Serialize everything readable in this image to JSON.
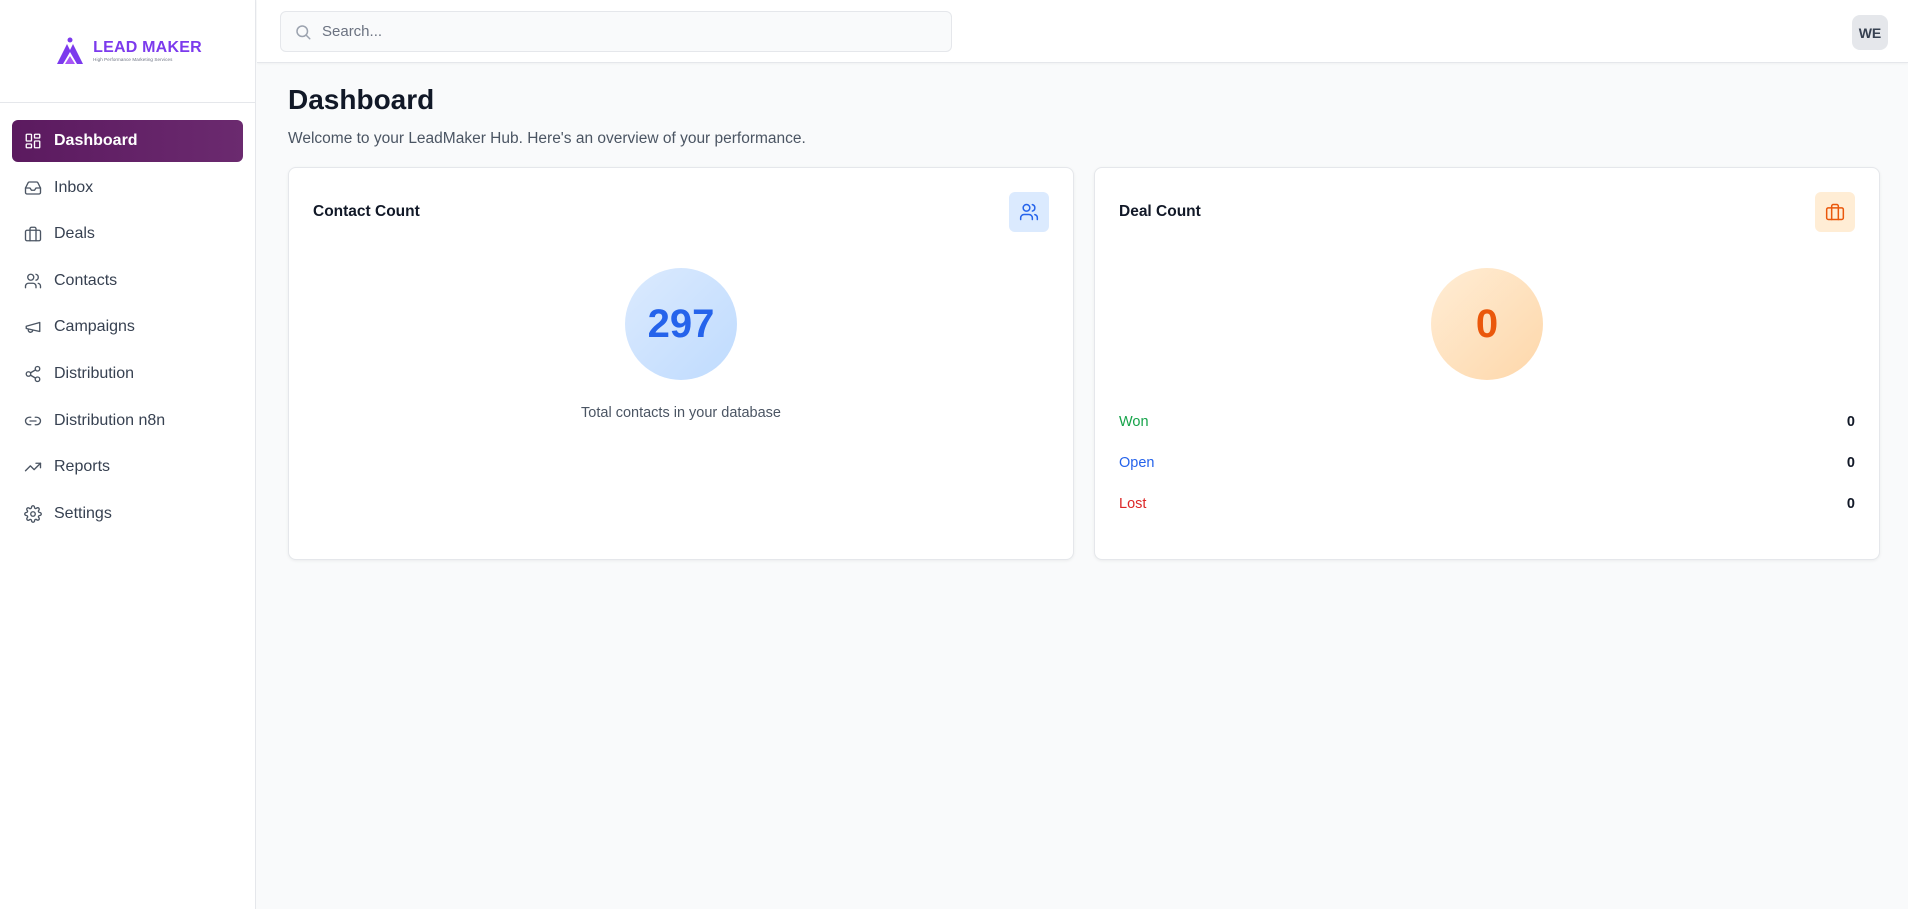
{
  "logo": {
    "title": "LEAD MAKER",
    "subtitle": "High Performance Marketing Services"
  },
  "sidebar": {
    "items": [
      {
        "label": "Dashboard",
        "icon": "grid-icon",
        "active": true
      },
      {
        "label": "Inbox",
        "icon": "inbox-icon"
      },
      {
        "label": "Deals",
        "icon": "briefcase-icon"
      },
      {
        "label": "Contacts",
        "icon": "users-icon"
      },
      {
        "label": "Campaigns",
        "icon": "megaphone-icon"
      },
      {
        "label": "Distribution",
        "icon": "share-icon"
      },
      {
        "label": "Distribution n8n",
        "icon": "link-icon"
      },
      {
        "label": "Reports",
        "icon": "trending-up-icon"
      },
      {
        "label": "Settings",
        "icon": "gear-icon"
      }
    ]
  },
  "topbar": {
    "search_placeholder": "Search...",
    "avatar_initials": "WE"
  },
  "main": {
    "title": "Dashboard",
    "subtitle": "Welcome to your LeadMaker Hub. Here's an overview of your performance."
  },
  "contact_card": {
    "title": "Contact Count",
    "icon": "users-icon",
    "count": "297",
    "caption": "Total contacts in your database"
  },
  "deal_card": {
    "title": "Deal Count",
    "icon": "briefcase-icon",
    "count": "0",
    "rows": [
      {
        "label": "Won",
        "value": "0",
        "color": "#16a34a"
      },
      {
        "label": "Open",
        "value": "0",
        "color": "#2563eb"
      },
      {
        "label": "Lost",
        "value": "0",
        "color": "#dc2626"
      }
    ]
  },
  "colors": {
    "active_nav": "#5b1a5f",
    "brand": "#7c3aed",
    "contact_accent": "#2563eb",
    "deal_accent": "#ea580c"
  }
}
